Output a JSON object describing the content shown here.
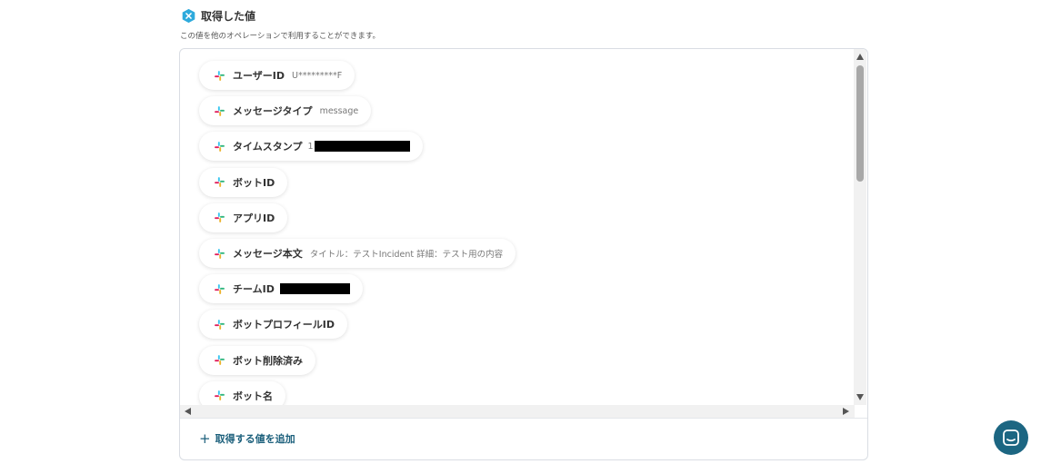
{
  "section": {
    "title": "取得した値",
    "description": "この値を他のオペレーションで利用することができます。"
  },
  "fields": [
    {
      "label": "ユーザーID",
      "value": "U*********F",
      "redacted": false
    },
    {
      "label": "メッセージタイプ",
      "value": "message",
      "redacted": false
    },
    {
      "label": "タイムスタンプ",
      "value": "1",
      "redacted": true
    },
    {
      "label": "ボットID",
      "value": "",
      "redacted": false
    },
    {
      "label": "アプリID",
      "value": "",
      "redacted": false
    },
    {
      "label": "メッセージ本文",
      "value": "タイトル：テストIncident 詳細：テスト用の内容",
      "redacted": false
    },
    {
      "label": "チームID",
      "value": "",
      "redacted": true
    },
    {
      "label": "ボットプロフィールID",
      "value": "",
      "redacted": false
    },
    {
      "label": "ボット削除済み",
      "value": "",
      "redacted": false
    },
    {
      "label": "ボット名",
      "value": "",
      "redacted": false
    }
  ],
  "add_button": {
    "label": "取得する値を追加"
  },
  "icons": {
    "section": "hexagon-x-icon",
    "field": "slack-icon",
    "chat": "chat-icon",
    "add": "plus-icon"
  },
  "colors": {
    "accent": "#1b5f7b",
    "chat_button": "#1c6682",
    "section_icon": "#2eaadc"
  }
}
